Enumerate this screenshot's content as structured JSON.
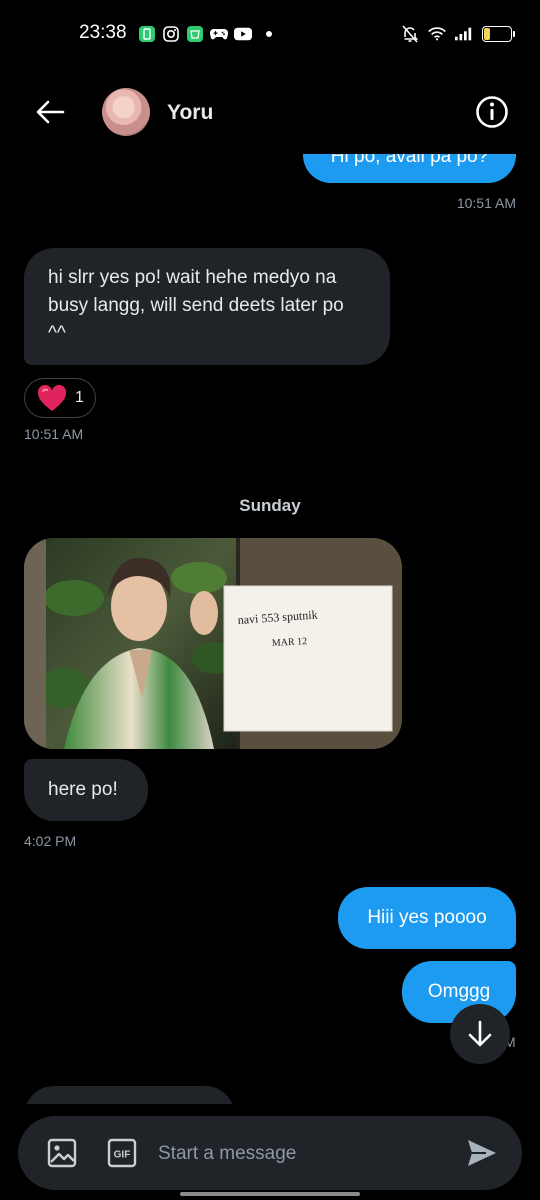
{
  "status_bar": {
    "time": "23:38",
    "battery": "20",
    "battery_level": 0.2
  },
  "header": {
    "contact_name": "Yoru"
  },
  "messages": [
    {
      "direction": "out",
      "text": "Hi po, avail pa po?",
      "time": "10:51 AM"
    },
    {
      "direction": "in",
      "text": "hi slrr yes po! wait hehe medyo na busy langg, will send deets later po ^^",
      "time": "10:51 AM",
      "reaction": {
        "emoji": "heart",
        "count": "1"
      }
    },
    {
      "direction": "in",
      "type": "image",
      "note_line1": "navi 553 sputnik",
      "note_line2": "MAR 12"
    },
    {
      "direction": "in",
      "text": "here po!",
      "time": "4:02 PM"
    },
    {
      "direction": "out",
      "text": "Hiii yes poooo"
    },
    {
      "direction": "out",
      "text": "Omggg",
      "time": "M"
    }
  ],
  "day_divider": "Sunday",
  "composer": {
    "placeholder": "Start a message",
    "gif_label": "GIF"
  },
  "colors": {
    "accent": "#1d9bf0",
    "incoming_bubble": "#202327",
    "background": "#000000",
    "meta_text": "#8b98a5"
  },
  "icons": [
    "back-arrow-icon",
    "info-icon",
    "heart-icon",
    "image-icon",
    "gif-icon",
    "send-icon",
    "arrow-down-icon"
  ]
}
